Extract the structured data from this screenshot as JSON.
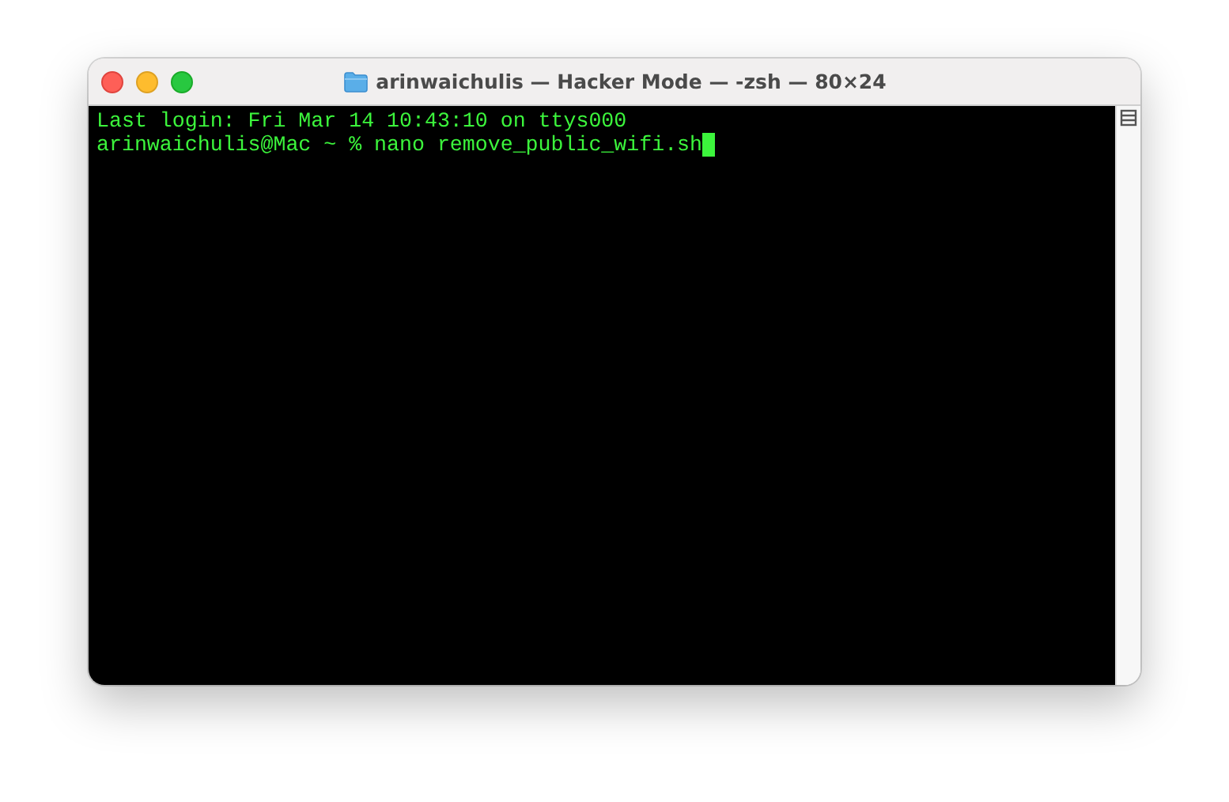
{
  "window": {
    "title": "arinwaichulis — Hacker Mode — -zsh — 80×24"
  },
  "terminal": {
    "lines": [
      "Last login: Fri Mar 14 10:43:10 on ttys000",
      "arinwaichulis@Mac ~ % nano remove_public_wifi.sh"
    ],
    "cursor": true
  }
}
